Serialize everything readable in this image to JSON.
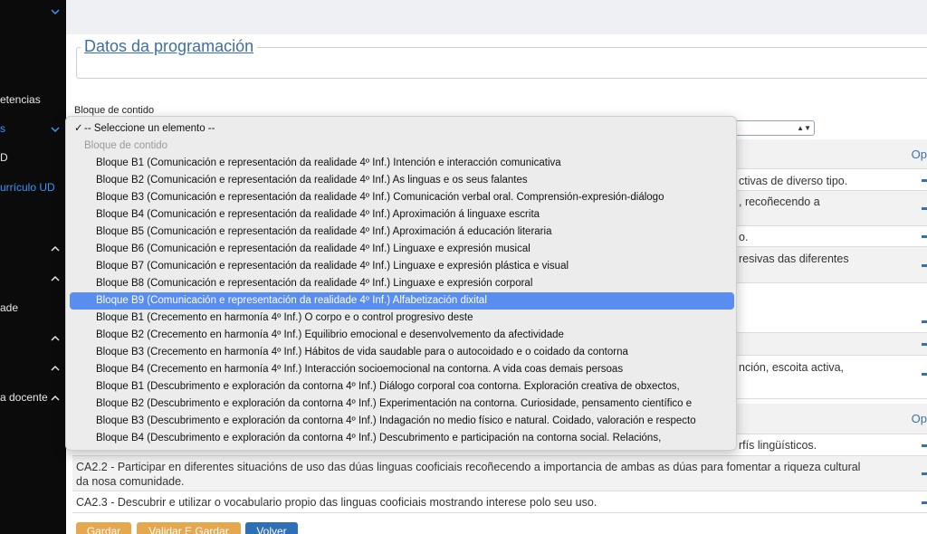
{
  "sidebar": {
    "items": [
      {
        "label": "",
        "chevron": "down"
      },
      {
        "label": "etencias",
        "chevron": ""
      },
      {
        "label": "s",
        "chevron": "down",
        "active": true
      },
      {
        "label": "D",
        "chevron": ""
      },
      {
        "label": "urrículo UD",
        "chevron": "",
        "active": true
      },
      {
        "label": "",
        "chevron": "up"
      },
      {
        "label": "",
        "chevron": "up"
      },
      {
        "label": "ade",
        "chevron": ""
      },
      {
        "label": "",
        "chevron": "up"
      },
      {
        "label": "",
        "chevron": "up"
      },
      {
        "label": "a docente",
        "chevron": "up"
      }
    ]
  },
  "legend": "Datos da programación",
  "field_label": "Bloque de contido",
  "table": {
    "options_header": "Op",
    "rows": [
      "ctivas de diverso tipo.",
      ", recoñecendo a",
      "o.",
      "resivas das diferentes",
      "",
      "",
      "nción, escoita activa,",
      "rfís lingüísticos.",
      "CA2.2 - Participar en diferentes situacións de uso das dúas linguas cooficiais recoñecendo a importancia de ambas as dúas para fomentar a riqueza cultural da nosa comunidade.",
      "CA2.3 - Descubrir e utilizar o vocabulario propio das linguas cooficiais mostrando interese polo seu uso."
    ]
  },
  "buttons": {
    "save": "Gardar",
    "validate": "Validar E Gardar",
    "back": "Volver"
  },
  "dropdown": {
    "selected_placeholder": "-- Seleccione un elemento --",
    "checkmark": "✓",
    "group_label": "Bloque de contido",
    "selected_index": 8,
    "options": [
      "Bloque B1 (Comunicación e representación da realidade 4º Inf.) Intención e interacción comunicativa",
      "Bloque B2 (Comunicación e representación da realidade 4º Inf.) As linguas e os seus falantes",
      "Bloque B3 (Comunicación e representación da realidade 4º Inf.) Comunicación verbal oral. Comprensión-expresión-diálogo",
      "Bloque B4 (Comunicación e representación da realidade 4º Inf.) Aproximación á linguaxe escrita",
      "Bloque B5 (Comunicación e representación da realidade 4º Inf.) Aproximación á educación literaria",
      "Bloque B6 (Comunicación e representación da realidade 4º Inf.) Linguaxe e expresión musical",
      "Bloque B7 (Comunicación e representación da realidade 4º Inf.) Linguaxe e expresión plástica e visual",
      "Bloque B8 (Comunicación e representación da realidade 4º Inf.) Linguaxe e expresión corporal",
      "Bloque B9 (Comunicación e representación da realidade 4º Inf.) Alfabetización dixital",
      "Bloque B1 (Crecemento en harmonía 4º Inf.) O corpo e o control progresivo deste",
      "Bloque B2 (Crecemento en harmonía 4º Inf.) Equilibrio emocional e desenvolvemento da afectividade",
      "Bloque B3 (Crecemento en harmonía 4º Inf.) Hábitos de vida saudable para o autocoidado e o coidado da contorna",
      "Bloque B4 (Crecemento en harmonía 4º Inf.) Interacción socioemocional na contorna. A vida coas demais persoas",
      "Bloque B1 (Descubrimento e exploración da contorna 4º Inf.) Diálogo corporal coa contorna. Exploración creativa de obxectos,",
      "Bloque B2 (Descubrimento e exploración da contorna 4º Inf.) Experimentación na contorna. Curiosidade, pensamento científico e",
      "Bloque B3 (Descubrimento e exploración da contorna 4º Inf.) Indagación no medio físico e natural. Coidado, valoración e respecto",
      "Bloque B4 (Descubrimento e exploración da contorna 4º Inf.) Descubrimento e participación na contorna social. Relacións,"
    ]
  },
  "colors": {
    "sidebar_bg": "#0b0b0b",
    "accent_blue": "#3b6fa8",
    "selection": "#5a8df0",
    "button_orange": "#e6a84e",
    "button_blue": "#2f6fb5"
  }
}
